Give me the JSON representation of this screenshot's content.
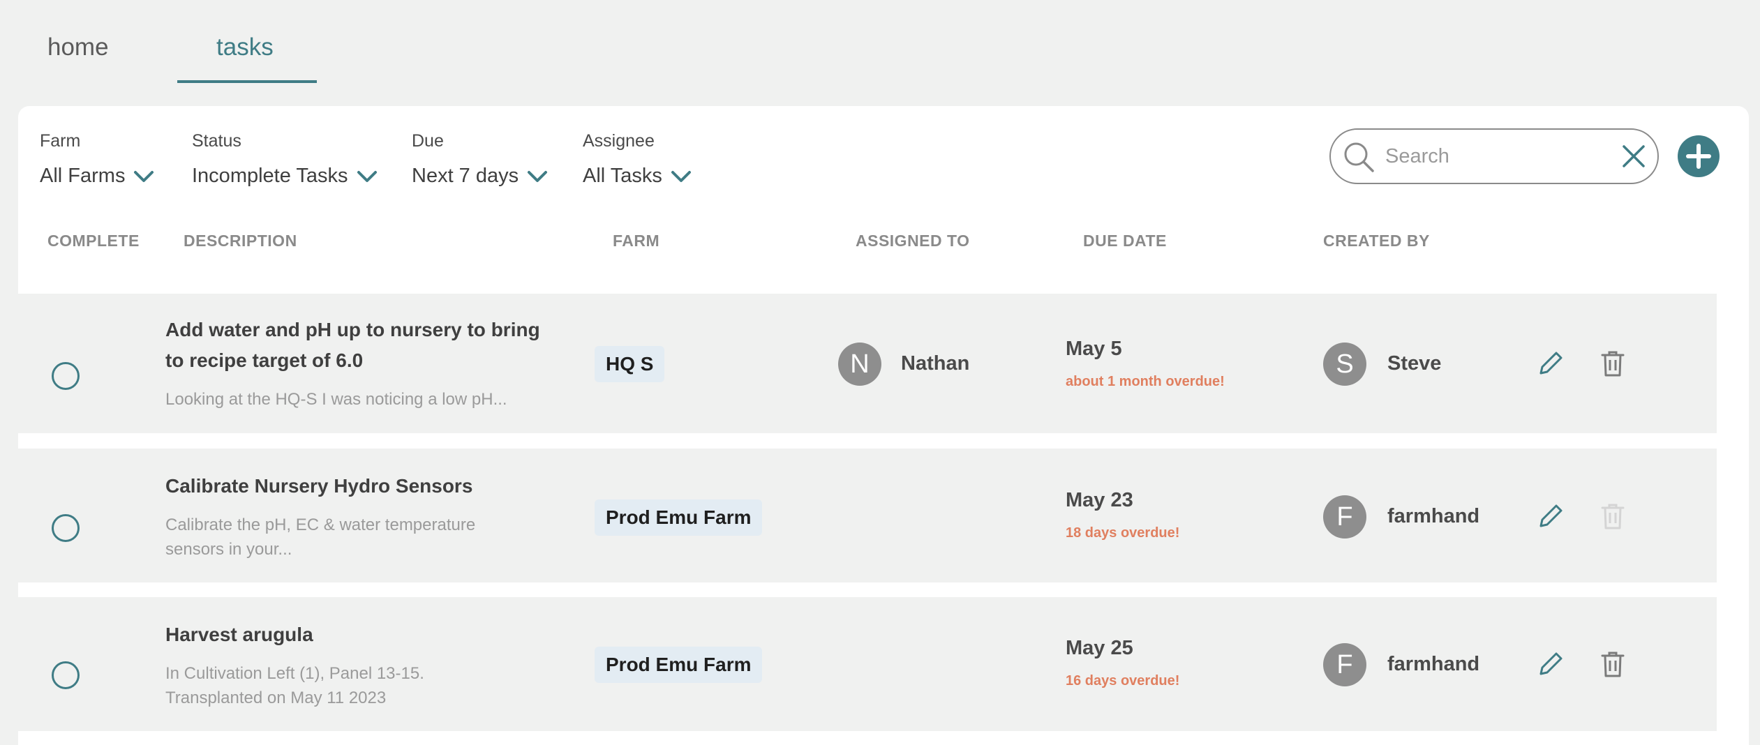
{
  "tabs": [
    {
      "label": "home",
      "active": false
    },
    {
      "label": "tasks",
      "active": true
    }
  ],
  "filters": {
    "farm": {
      "label": "Farm",
      "value": "All Farms"
    },
    "status": {
      "label": "Status",
      "value": "Incomplete Tasks"
    },
    "due": {
      "label": "Due",
      "value": "Next 7 days"
    },
    "assignee": {
      "label": "Assignee",
      "value": "All Tasks"
    }
  },
  "search": {
    "placeholder": "Search",
    "value": ""
  },
  "columns": {
    "complete": "COMPLETE",
    "description": "DESCRIPTION",
    "farm": "FARM",
    "assigned_to": "ASSIGNED TO",
    "due_date": "DUE DATE",
    "created_by": "CREATED BY"
  },
  "rows": [
    {
      "title": "Add water and pH up to nursery to bring to recipe target of 6.0",
      "description": "Looking at the HQ-S I was noticing a low pH...",
      "farm": "HQ S",
      "assignee_initial": "N",
      "assignee": "Nathan",
      "due": "May 5",
      "overdue": "about 1 month overdue!",
      "creator_initial": "S",
      "creator": "Steve",
      "delete_enabled": true
    },
    {
      "title": "Calibrate Nursery Hydro Sensors",
      "description": "Calibrate the pH, EC & water temperature sensors in your...",
      "farm": "Prod Emu Farm",
      "assignee_initial": "",
      "assignee": "",
      "due": "May 23",
      "overdue": "18 days overdue!",
      "creator_initial": "F",
      "creator": "farmhand",
      "delete_enabled": false
    },
    {
      "title": "Harvest arugula",
      "description": "In Cultivation Left (1), Panel 13-15. Transplanted on May 11 2023",
      "farm": "Prod Emu Farm",
      "assignee_initial": "",
      "assignee": "",
      "due": "May 25",
      "overdue": "16 days overdue!",
      "creator_initial": "F",
      "creator": "farmhand",
      "delete_enabled": true
    }
  ],
  "colors": {
    "accent": "#3f7c85",
    "overdue": "#e07f5f",
    "badge_bg": "#e3ecf3",
    "row_bg": "#f0f1f0",
    "avatar_bg": "#8e8e8e"
  },
  "icons": {
    "dropdown": "chevron-down-icon",
    "search": "search-icon",
    "clear": "close-icon",
    "add": "plus-icon",
    "edit": "pencil-icon",
    "delete": "trash-icon"
  }
}
